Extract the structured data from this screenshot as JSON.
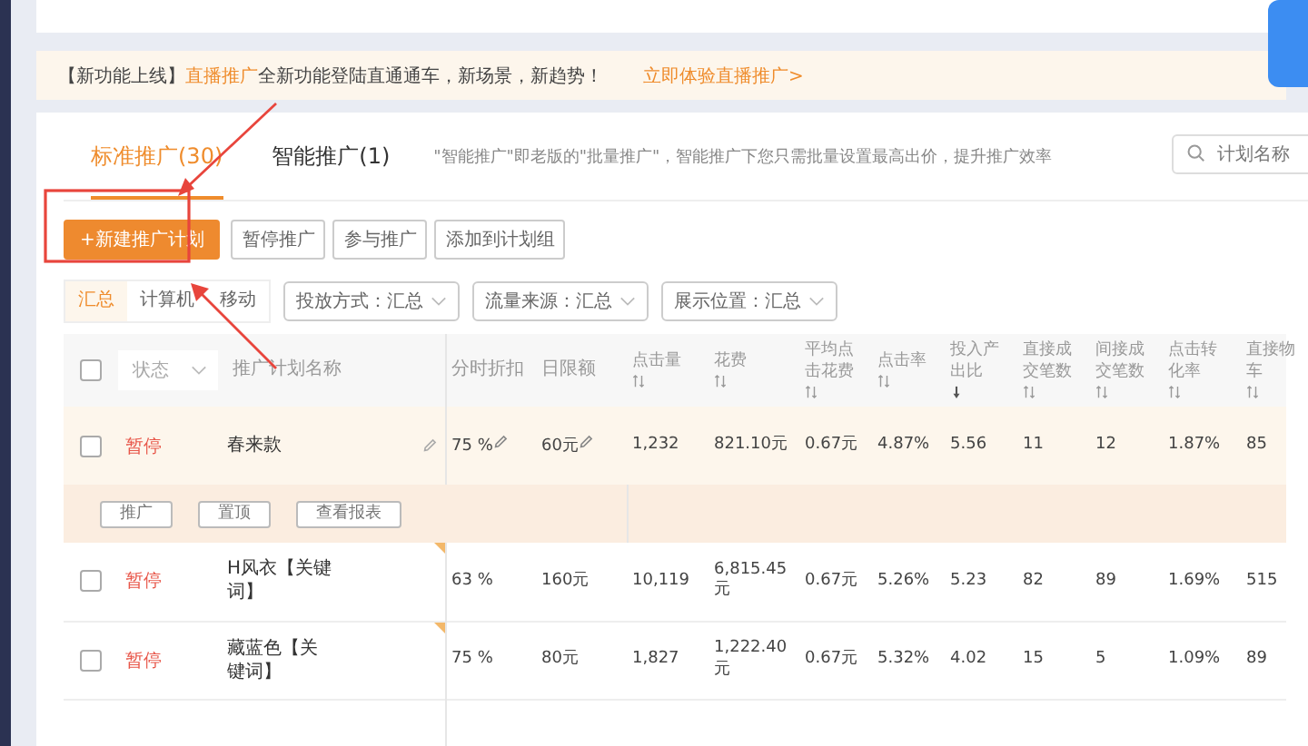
{
  "notice": {
    "parts": [
      {
        "text": "【新功能上线】",
        "highlight": false
      },
      {
        "text": "直播推广",
        "highlight": true
      },
      {
        "text": "全新功能登陆直通通车，新场景，新趋势！",
        "highlight": false
      }
    ],
    "link": "立即体验直播推广>"
  },
  "tabs": [
    {
      "label": "标准推广(30)",
      "selected": true
    },
    {
      "label": "智能推广(1)",
      "selected": false
    }
  ],
  "tab_hint": "\"智能推广\"即老版的\"批量推广\"，智能推广下您只需批量设置最高出价，提升推广效率",
  "search": {
    "placeholder": "计划名称"
  },
  "buttons": [
    {
      "label": "+新建推广计划",
      "primary": true
    },
    {
      "label": "暂停推广",
      "primary": false
    },
    {
      "label": "参与推广",
      "primary": false
    },
    {
      "label": "添加到计划组",
      "primary": false
    }
  ],
  "device_tabs": [
    {
      "label": "汇总",
      "selected": true
    },
    {
      "label": "计算机",
      "selected": false
    },
    {
      "label": "移动",
      "selected": false
    }
  ],
  "filters": [
    "投放方式：汇总",
    "流量来源：汇总",
    "展示位置：汇总"
  ],
  "table": {
    "select_all_checked": false,
    "columns": [
      {
        "label": "状态",
        "kind": "filter"
      },
      {
        "label": "推广计划名称",
        "kind": "plain"
      },
      {
        "label": "分时折扣",
        "kind": "plain"
      },
      {
        "label": "日限额",
        "kind": "plain"
      },
      {
        "label": "点击量",
        "kind": "sortable",
        "sorted_desc": false
      },
      {
        "label": "花费",
        "kind": "sortable",
        "sorted_desc": false
      },
      {
        "label": "平均点击花费",
        "kind": "sortable",
        "sorted_desc": false
      },
      {
        "label": "点击率",
        "kind": "sortable",
        "sorted_desc": false
      },
      {
        "label": "投入产出比",
        "kind": "sortable",
        "sorted_desc": true
      },
      {
        "label": "直接成交笔数",
        "kind": "sortable",
        "sorted_desc": false
      },
      {
        "label": "间接成交笔数",
        "kind": "sortable",
        "sorted_desc": false
      },
      {
        "label": "点击转化率",
        "kind": "sortable",
        "sorted_desc": false
      },
      {
        "label": "直接物车",
        "kind": "sortable",
        "sorted_desc": false
      }
    ],
    "rows": [
      {
        "checked": false,
        "highlighted": true,
        "flagged": false,
        "cells": [
          "暂停",
          "春来款",
          "75 %",
          "60元",
          "1,232",
          "821.10元",
          "0.67元",
          "4.87%",
          "5.56",
          "11",
          "12",
          "1.87%",
          "85"
        ],
        "actions": [
          "推广",
          "置顶",
          "查看报表"
        ]
      },
      {
        "checked": false,
        "highlighted": false,
        "flagged": true,
        "cells": [
          "暂停",
          "H风衣【关键词】",
          "63 %",
          "160元",
          "10,119",
          "6,815.45元",
          "0.67元",
          "5.26%",
          "5.23",
          "82",
          "89",
          "1.69%",
          "515"
        ]
      },
      {
        "checked": false,
        "highlighted": false,
        "flagged": true,
        "cells": [
          "暂停",
          "藏蓝色【关键词】",
          "75 %",
          "80元",
          "1,827",
          "1,222.40元",
          "0.67元",
          "5.32%",
          "4.02",
          "15",
          "5",
          "1.09%",
          "89"
        ]
      }
    ]
  }
}
